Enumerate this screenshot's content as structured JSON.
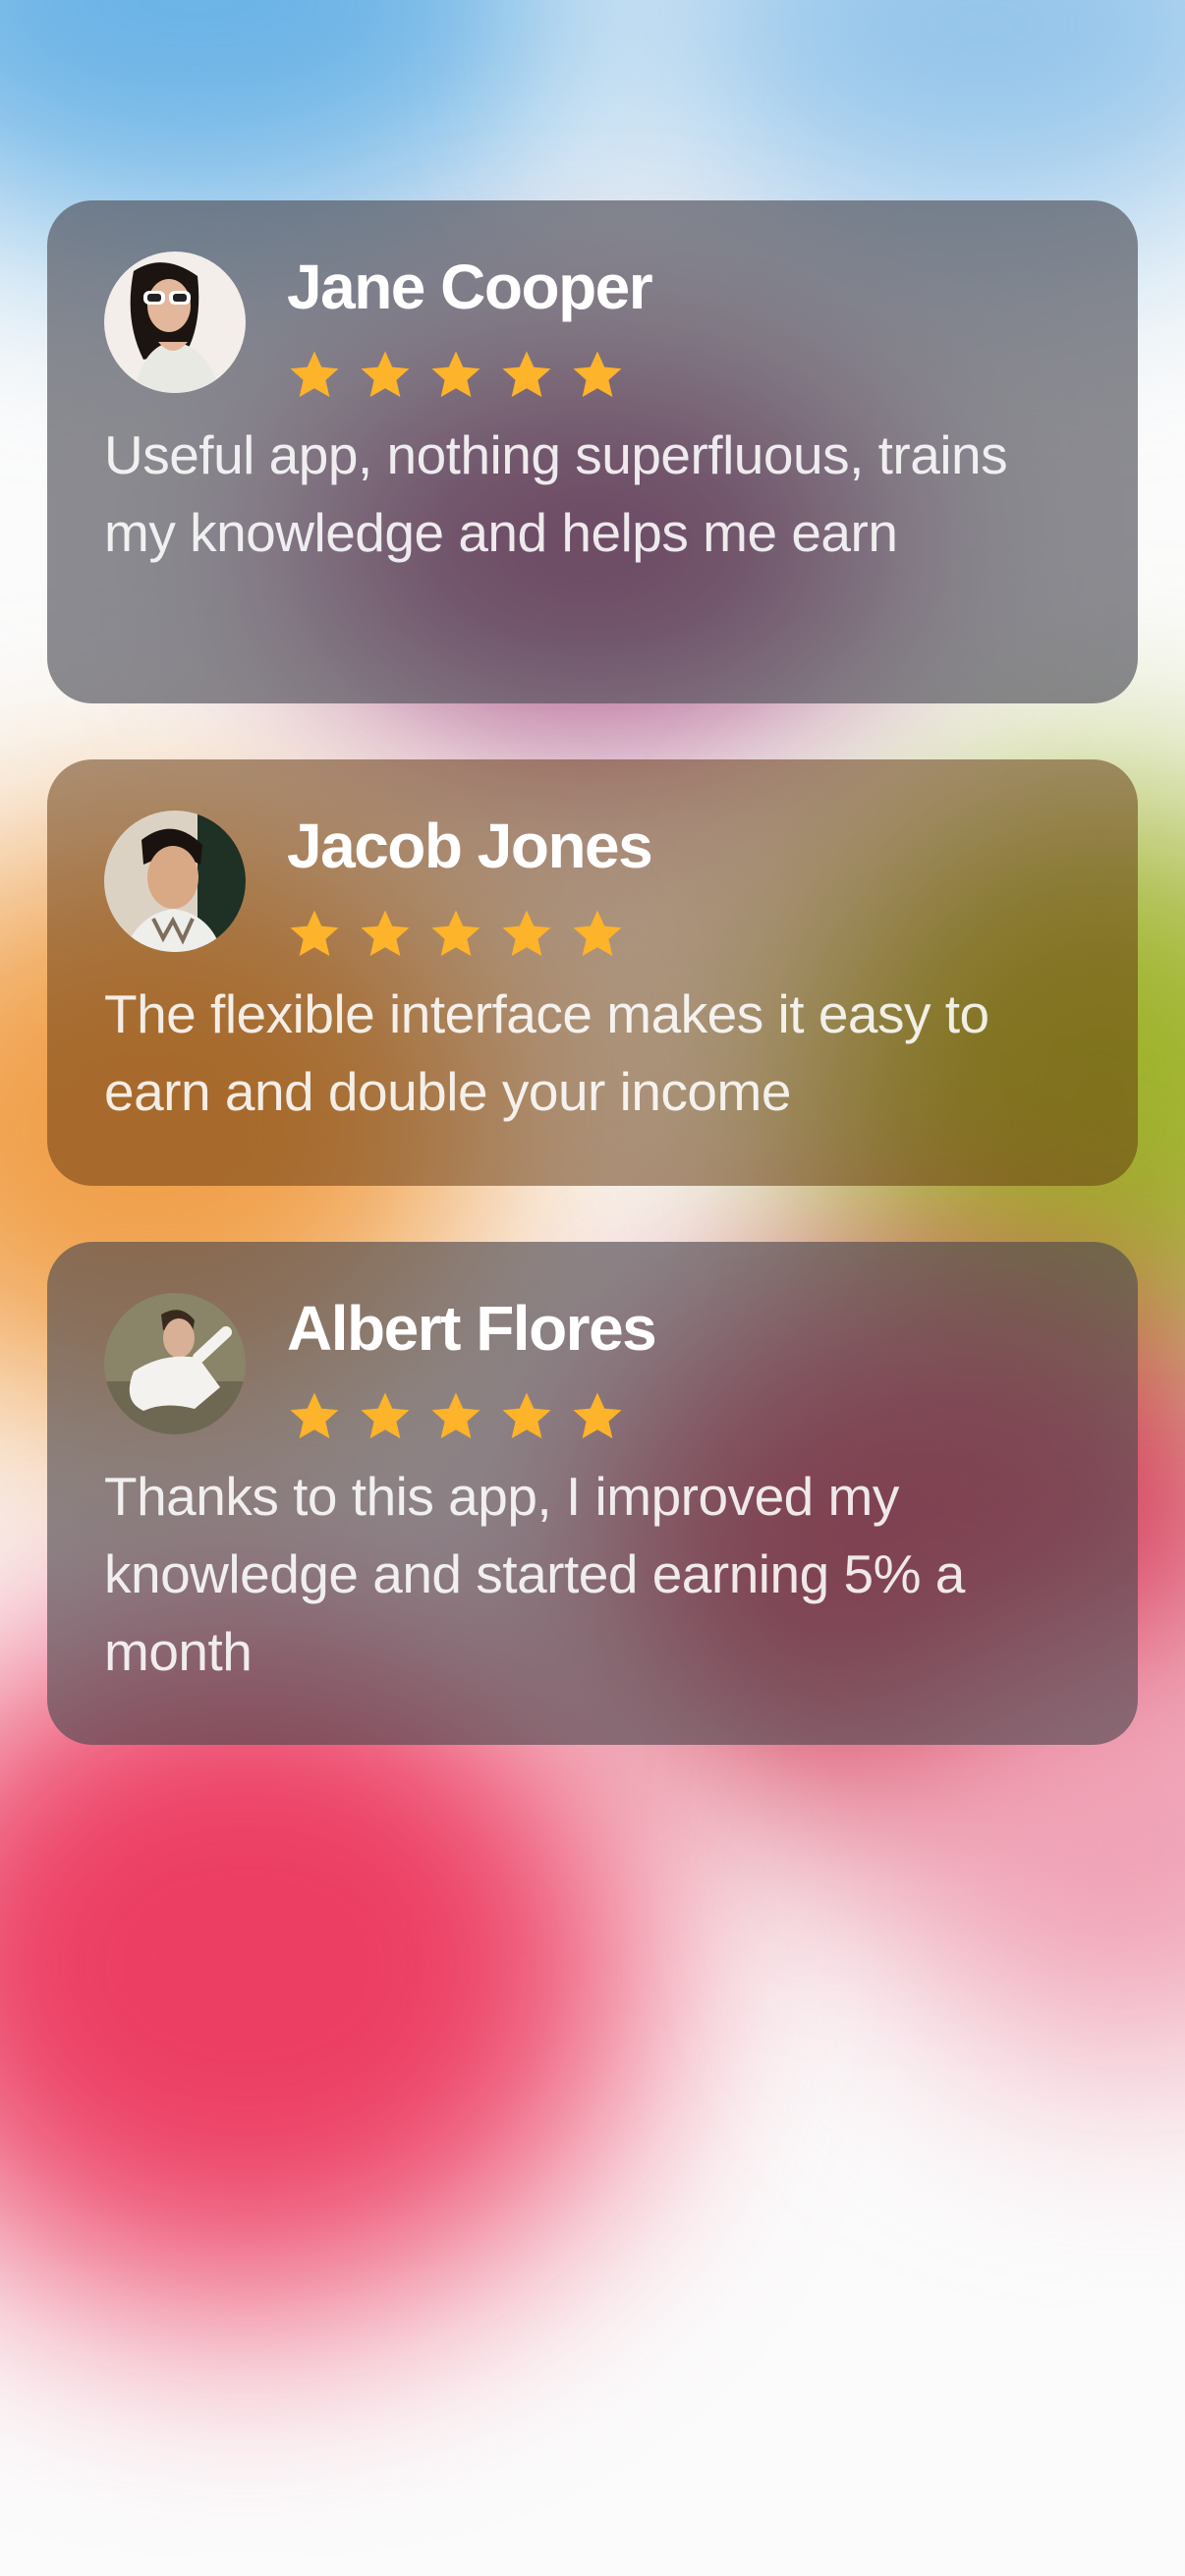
{
  "colors": {
    "star": "#FDB32A",
    "name_text": "#FFFFFF",
    "body_text": "#EDEDED"
  },
  "reviews": [
    {
      "name": "Jane Cooper",
      "rating": 5,
      "text": "Useful app, nothing superfluous, trains my knowledge and helps me earn",
      "avatar_icon": "woman-with-sunglasses-avatar"
    },
    {
      "name": "Jacob Jones",
      "rating": 5,
      "text": "The flexible interface makes it easy to earn and double your income",
      "avatar_icon": "young-man-avatar"
    },
    {
      "name": "Albert Flores",
      "rating": 5,
      "text": "Thanks to this app, I improved my knowledge and started earning 5% a month",
      "avatar_icon": "man-in-white-shirt-avatar"
    }
  ]
}
